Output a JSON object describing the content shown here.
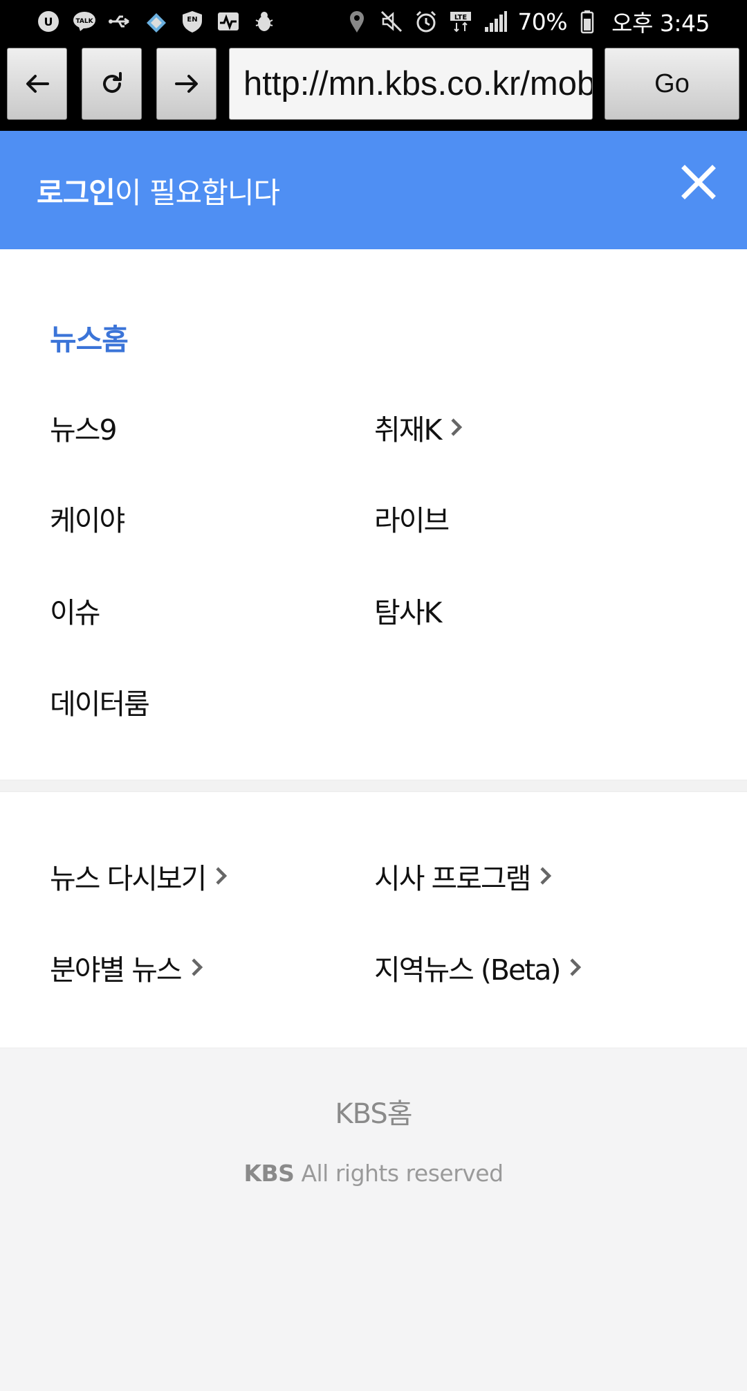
{
  "status_bar": {
    "battery": "70%",
    "time": "오후 3:45",
    "left_icons": [
      "u-plus-icon",
      "kakao-talk-icon",
      "usb-icon",
      "tv-icon",
      "shield-en-icon",
      "activity-icon",
      "bug-icon"
    ],
    "right_icons": [
      "location-icon",
      "mute-icon",
      "alarm-icon",
      "lte-icon",
      "signal-icon",
      "battery-icon"
    ]
  },
  "browser": {
    "url": "http://mn.kbs.co.kr/mobile/",
    "go_label": "Go"
  },
  "login_banner": {
    "bold": "로그인",
    "rest": "이 필요합니다"
  },
  "menu": {
    "home": "뉴스홈",
    "items": [
      {
        "label": "뉴스9",
        "arrow": false
      },
      {
        "label": "취재K",
        "arrow": true
      },
      {
        "label": "케이야",
        "arrow": false
      },
      {
        "label": "라이브",
        "arrow": false
      },
      {
        "label": "이슈",
        "arrow": false
      },
      {
        "label": "탐사K",
        "arrow": false
      },
      {
        "label": "데이터룸",
        "arrow": false
      }
    ],
    "sub_items": [
      {
        "label": "뉴스 다시보기",
        "arrow": true
      },
      {
        "label": "시사 프로그램",
        "arrow": true
      },
      {
        "label": "분야별 뉴스",
        "arrow": true
      },
      {
        "label": "지역뉴스 (Beta)",
        "arrow": true
      }
    ]
  },
  "footer": {
    "home": "KBS홈",
    "brand": "KBS",
    "rights": "All rights reserved"
  },
  "colors": {
    "accent": "#4f8ff3",
    "home_link": "#3b74d8"
  }
}
